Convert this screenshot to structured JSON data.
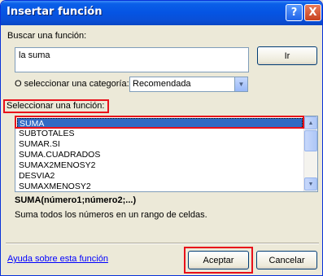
{
  "window": {
    "title": "Insertar función",
    "help_glyph": "?",
    "close_glyph": "X"
  },
  "search": {
    "label": "Buscar una función:",
    "value": "la suma",
    "go_button": "Ir"
  },
  "category": {
    "label": "O seleccionar una categoría:",
    "selected": "Recomendada"
  },
  "function_list": {
    "label": "Seleccionar una función:",
    "items": [
      "SUMA",
      "SUBTOTALES",
      "SUMAR.SI",
      "SUMA.CUADRADOS",
      "SUMAX2MENOSY2",
      "DESVIA2",
      "SUMAXMENOSY2"
    ],
    "selected_index": 0
  },
  "details": {
    "signature": "SUMA(número1;número2;...)",
    "description": "Suma todos los números en un rango de celdas."
  },
  "footer": {
    "help_link": "Ayuda sobre esta función",
    "ok_button": "Aceptar",
    "cancel_button": "Cancelar"
  }
}
